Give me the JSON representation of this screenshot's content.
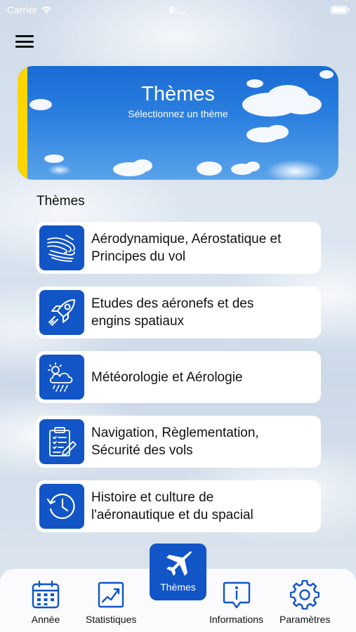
{
  "status_bar": {
    "carrier": "Carrier",
    "time": "9:…"
  },
  "header": {
    "menu_icon": "hamburger-menu-icon"
  },
  "banner": {
    "title": "Thèmes",
    "subtitle": "Sélectionnez un thème",
    "accent_color": "#ffd500"
  },
  "section_title": "Thèmes",
  "themes": [
    {
      "line1": "Aérodynamique, Aérostatique et",
      "line2": "Principes du vol",
      "icon": "airflow-icon"
    },
    {
      "line1": "Etudes des aéronefs et des",
      "line2": "engins spatiaux",
      "icon": "rocket-icon"
    },
    {
      "line1": "Météorologie et Aérologie",
      "line2": "",
      "icon": "weather-icon"
    },
    {
      "line1": "Navigation, Règlementation,",
      "line2": "Sécurité des vols",
      "icon": "clipboard-icon"
    },
    {
      "line1": "Histoire et culture de",
      "line2": "l'aéronautique et du spacial",
      "icon": "history-clock-icon"
    }
  ],
  "tab_bar": {
    "annee": "Année",
    "statistiques": "Statistiques",
    "themes": "Thèmes",
    "informations": "Informations",
    "parametres": "Paramètres",
    "active": "themes"
  },
  "colors": {
    "primary": "#1155c6",
    "accent": "#ffd500"
  }
}
